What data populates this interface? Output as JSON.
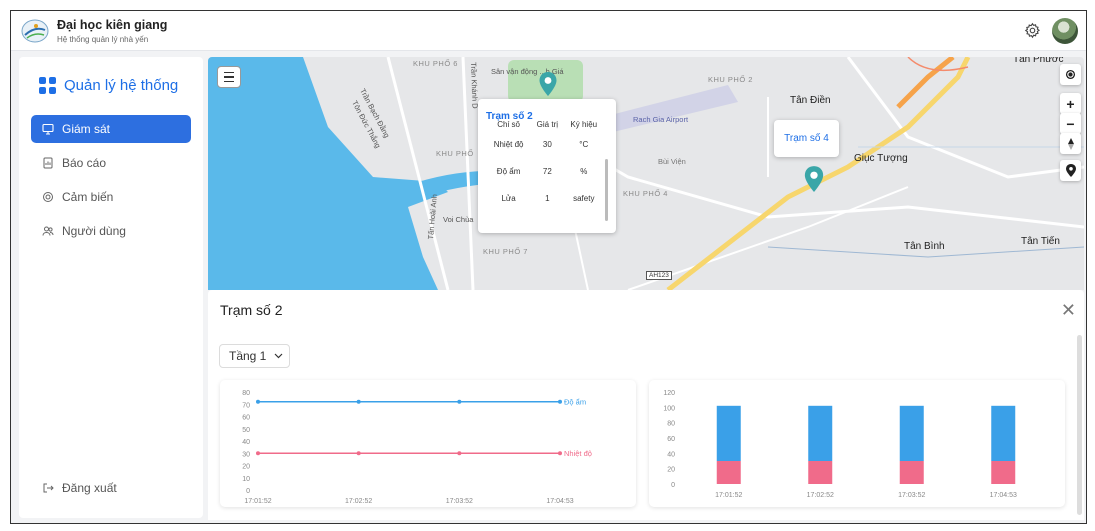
{
  "header": {
    "title": "Đại học kiên giang",
    "subtitle": "Hệ thống quản lý nhà yến"
  },
  "sidebar": {
    "brand": "Quản lý hệ thống",
    "items": [
      {
        "label": "Giám sát",
        "icon": "monitor-icon",
        "active": true
      },
      {
        "label": "Báo cáo",
        "icon": "report-icon",
        "active": false
      },
      {
        "label": "Cảm biến",
        "icon": "sensor-icon",
        "active": false
      },
      {
        "label": "Người dùng",
        "icon": "users-icon",
        "active": false
      }
    ],
    "logout": "Đăng xuất"
  },
  "map": {
    "places": {
      "tan_phuoc": "Tân Phước",
      "tan_dien": "Tân Điền",
      "giuc_tuong": "Giục Tượng",
      "tan_binh": "Tân Bình",
      "tan_tien": "Tân Tiến",
      "airport": "Rach Gia Airport",
      "stadium": "Sân vận động ...h Giá",
      "kp6": "KHU PHỐ 6",
      "kp2": "KHU PHỐ 2",
      "kp4": "KHU PHỐ 4",
      "kp7": "KHU PHỐ 7",
      "khu_pho": "KHU PHỐ",
      "highway": "AH123",
      "bui_vien": "Bùi Viện",
      "voi_chua": "Voi Chùa",
      "tran_bach_dang": "Trần Bạch Đằng",
      "ton_duc_thang": "Tôn Đức Thắng",
      "tran_khanh_du": "Trần Khánh D",
      "tan_hoai_anh": "Tấn Hoài Anh"
    },
    "station2_popup": {
      "title": "Trạm số 2",
      "headers": [
        "Chỉ số",
        "Giá trị",
        "Ký hiệu"
      ],
      "rows": [
        {
          "name": "Nhiệt độ",
          "value": "30",
          "unit": "°C"
        },
        {
          "name": "Độ ẩm",
          "value": "72",
          "unit": "%"
        },
        {
          "name": "Lửa",
          "value": "1",
          "unit": "safety"
        }
      ]
    },
    "station4_label": "Trạm số 4",
    "pin_color": "#3aa6a8"
  },
  "panel": {
    "title": "Trạm số 2",
    "floor_select": "Tầng 1"
  },
  "chart_data": [
    {
      "type": "line",
      "x": [
        "17:01:52",
        "17:02:52",
        "17:03:52",
        "17:04:53"
      ],
      "ylim": [
        0,
        80
      ],
      "yticks": [
        0,
        10,
        20,
        30,
        40,
        50,
        60,
        70,
        80
      ],
      "series": [
        {
          "name": "Độ ẩm",
          "values": [
            72,
            72,
            72,
            72
          ],
          "color": "#3aa0e8"
        },
        {
          "name": "Nhiệt độ",
          "values": [
            30,
            30,
            30,
            30
          ],
          "color": "#f06b8a"
        }
      ]
    },
    {
      "type": "bar",
      "stacked": true,
      "categories": [
        "17:01:52",
        "17:02:52",
        "17:03:52",
        "17:04:53"
      ],
      "ylim": [
        0,
        120
      ],
      "yticks": [
        0,
        20,
        40,
        60,
        80,
        100,
        120
      ],
      "series": [
        {
          "values": [
            30,
            30,
            30,
            30
          ],
          "color": "#f06b8a"
        },
        {
          "values": [
            72,
            72,
            72,
            72
          ],
          "color": "#3aa0e8"
        }
      ]
    }
  ]
}
